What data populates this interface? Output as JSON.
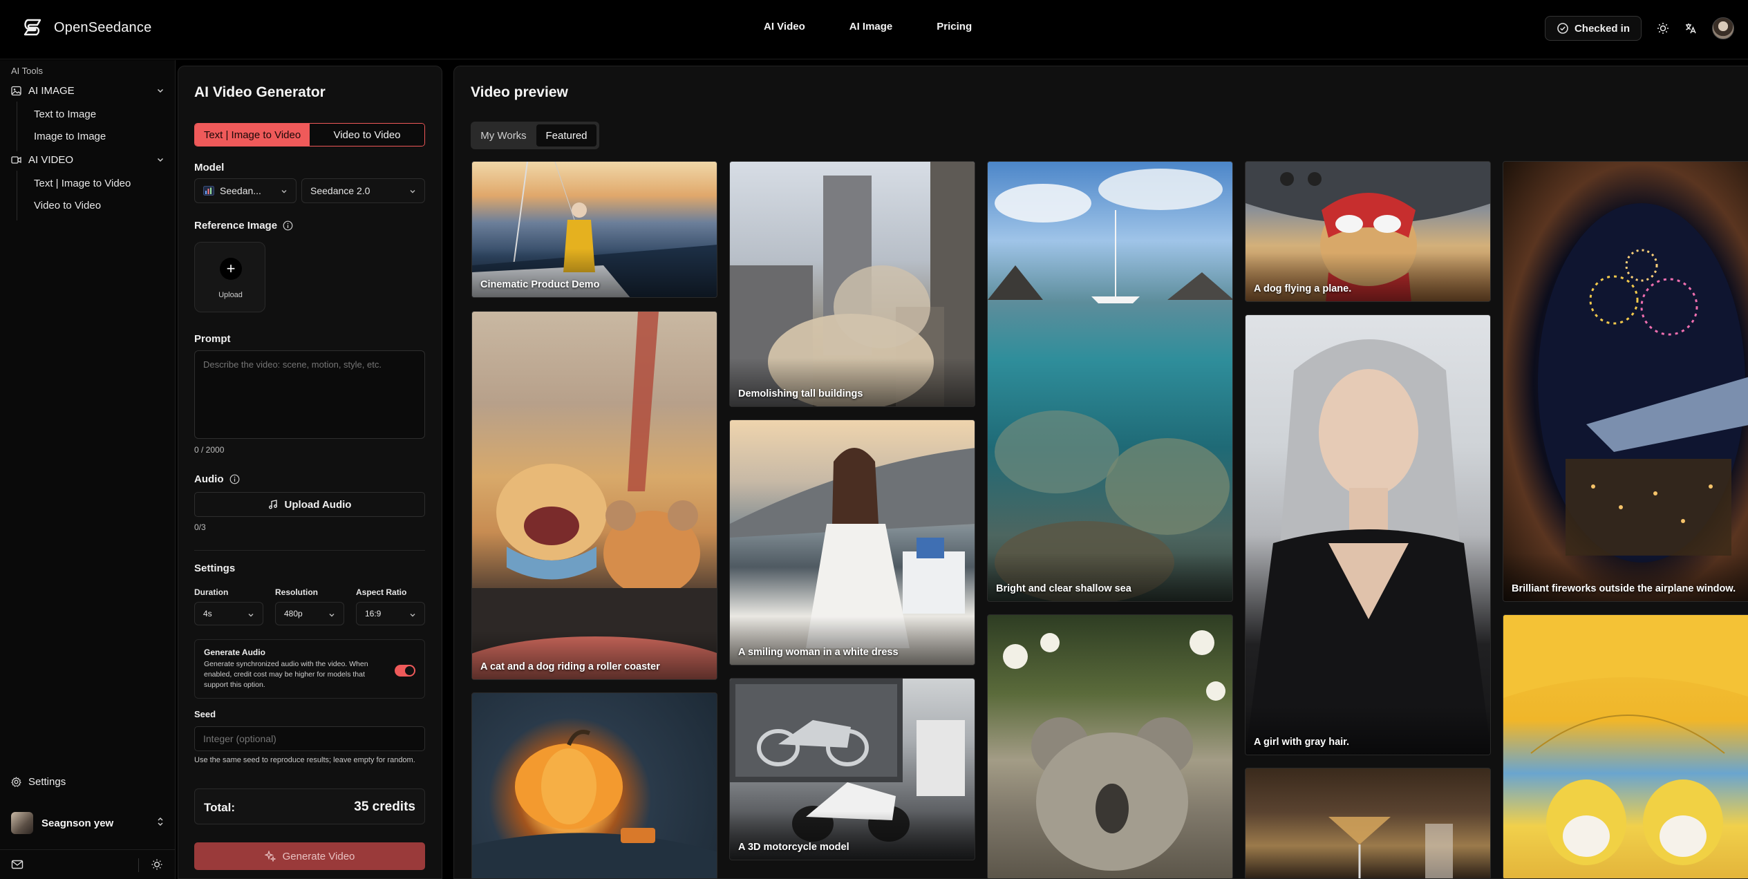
{
  "brand": {
    "name": "OpenSeedance"
  },
  "topnav": {
    "items": [
      "AI Video",
      "AI Image",
      "Pricing"
    ]
  },
  "header_right": {
    "checkin_label": "Checked in"
  },
  "sidebar": {
    "section_title": "AI Tools",
    "groups": [
      {
        "label": "AI IMAGE",
        "icon": "image-icon",
        "items": [
          "Text to Image",
          "Image to Image"
        ]
      },
      {
        "label": "AI VIDEO",
        "icon": "video-icon",
        "items": [
          "Text | Image to Video",
          "Video to Video"
        ]
      }
    ],
    "settings_label": "Settings",
    "user_name": "Seagnson yew"
  },
  "generator": {
    "title": "AI Video Generator",
    "mode_tabs": [
      "Text | Image to Video",
      "Video to Video"
    ],
    "active_mode": "Text | Image to Video",
    "model_label": "Model",
    "model_provider": "Seedan...",
    "model_version": "Seedance 2.0",
    "reference_label": "Reference Image",
    "upload_label": "Upload",
    "prompt_label": "Prompt",
    "prompt_placeholder": "Describe the video: scene, motion, style, etc.",
    "prompt_counter": "0 / 2000",
    "audio_label": "Audio",
    "upload_audio_label": "Upload Audio",
    "audio_counter": "0/3",
    "settings_label": "Settings",
    "duration_label": "Duration",
    "duration_value": "4s",
    "resolution_label": "Resolution",
    "resolution_value": "480p",
    "aspect_label": "Aspect Ratio",
    "aspect_value": "16:9",
    "gen_audio_title": "Generate Audio",
    "gen_audio_desc": "Generate synchronized audio with the video. When enabled, credit cost may be higher for models that support this option.",
    "gen_audio_enabled": true,
    "seed_label": "Seed",
    "seed_placeholder": "Integer (optional)",
    "seed_help": "Use the same seed to reproduce results; leave empty for random.",
    "total_label": "Total:",
    "total_value": "35 credits",
    "generate_label": "Generate Video",
    "accent_color": "#ef5a5a"
  },
  "preview": {
    "title": "Video preview",
    "tabs": [
      "My Works",
      "Featured"
    ],
    "active_tab": "Featured",
    "cards": [
      "Cinematic Product Demo",
      "A cat and a dog riding a roller coaster",
      "",
      "Demolishing tall buildings",
      "A smiling woman in a white dress",
      "A 3D motorcycle model",
      "Bright and clear shallow sea",
      "",
      "A dog flying a plane.",
      "A girl with gray hair.",
      "",
      "Brilliant fireworks outside the airplane window.",
      ""
    ]
  }
}
